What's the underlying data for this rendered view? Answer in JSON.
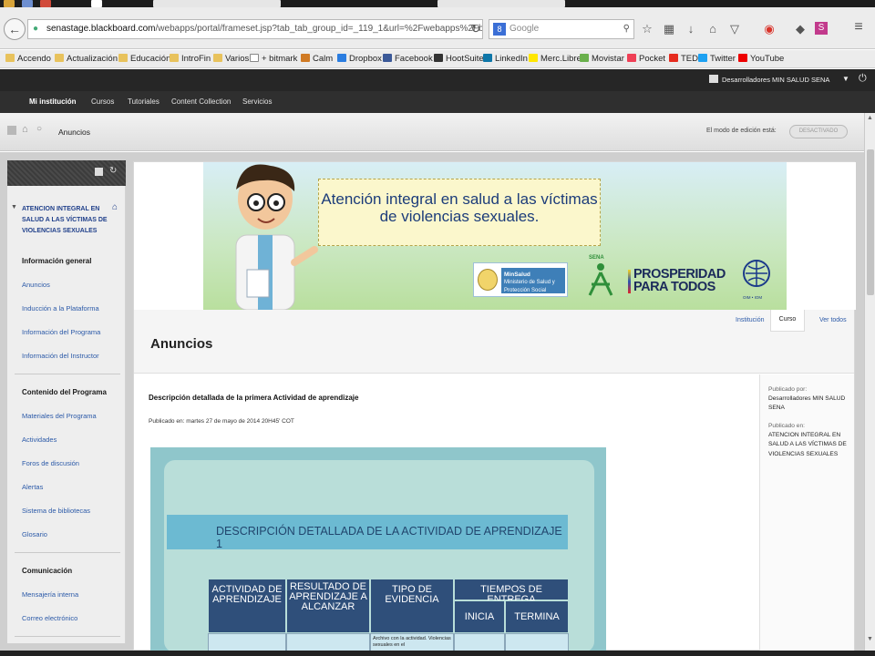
{
  "browser": {
    "url_host": "senastage.blackboard.com",
    "url_path": "/webapps/portal/frameset.jsp?tab_tab_group_id=_119_1&url=%2Fwebapps%2Fblackboard%",
    "search_engine": "Google",
    "icons": [
      "back-icon",
      "lock-icon",
      "reload-icon",
      "search-icon",
      "star-icon",
      "clipboard-icon",
      "download-icon",
      "home-icon",
      "pocket-icon",
      "extension-icon",
      "menu-icon"
    ]
  },
  "bookmarks": [
    {
      "label": "Accendo"
    },
    {
      "label": "Actualización"
    },
    {
      "label": "Educación"
    },
    {
      "label": "IntroFin"
    },
    {
      "label": "Varios"
    },
    {
      "label": "+ bitmark"
    },
    {
      "label": "Calm"
    },
    {
      "label": "Dropbox"
    },
    {
      "label": "Facebook"
    },
    {
      "label": "HootSuite"
    },
    {
      "label": "LinkedIn"
    },
    {
      "label": "Merc.Libre"
    },
    {
      "label": "Movistar"
    },
    {
      "label": "Pocket"
    },
    {
      "label": "TED"
    },
    {
      "label": "Twitter"
    },
    {
      "label": "YouTube"
    }
  ],
  "bb_header": {
    "tabs": [
      {
        "label": "Mi institución",
        "active": true
      },
      {
        "label": "Cursos"
      },
      {
        "label": "Tutoriales"
      },
      {
        "label": "Content Collection"
      },
      {
        "label": "Servicios"
      }
    ],
    "user": "Desarrolladores MIN SALUD SENA"
  },
  "breadcrumb": {
    "current": "Anuncios",
    "edit_mode_label": "El modo de edición está:",
    "edit_mode_value": "DESACTIVADO"
  },
  "sidebar": {
    "course_name": "ATENCION INTEGRAL EN SALUD A LAS VÍCTIMAS DE VIOLENCIAS SEXUALES",
    "sections": [
      {
        "title": "Información general",
        "items": [
          "Anuncios",
          "Inducción a la Plataforma",
          "Información del Programa",
          "Información del Instructor"
        ]
      },
      {
        "title": "Contenido del Programa",
        "items": [
          "Materiales del Programa",
          "Actividades",
          "Foros de discusión",
          "Alertas",
          "Sistema de bibliotecas",
          "Glosario"
        ]
      },
      {
        "title": "Comunicación",
        "items": [
          "Mensajería interna",
          "Correo electrónico"
        ]
      }
    ]
  },
  "banner": {
    "title": "Atención integral en salud a las víctimas de violencias sexuales.",
    "logo_minsalud": "MinSalud",
    "logo_minsalud_sub": "Ministerio de Salud y Protección Social",
    "logo_sena": "SENA",
    "logo_prosperidad": "PROSPERIDAD PARA TODOS",
    "logo_oim": "OIM • IOM"
  },
  "announcements": {
    "heading": "Anuncios",
    "tabs": [
      "Institución",
      "Curso",
      "Ver todos"
    ],
    "post": {
      "title": "Descripción detallada de la primera Actividad de aprendizaje",
      "published": "Publicado en: martes 27 de mayo de 2014 20H45' COT",
      "side_published_by_label": "Publicado por:",
      "side_author": "Desarrolladores MIN SALUD SENA",
      "side_published_in_label": "Publicado en:",
      "side_course": "ATENCION INTEGRAL EN SALUD A LAS VÍCTIMAS DE VIOLENCIAS SEXUALES"
    },
    "embedded": {
      "title": "DESCRIPCIÓN DETALLADA DE LA ACTIVIDAD DE APRENDIZAJE 1",
      "col_activity": "ACTIVIDAD DE APRENDIZAJE",
      "col_result": "RESULTADO DE APRENDIZAJE A ALCANZAR",
      "col_evidence": "TIPO DE EVIDENCIA",
      "col_times": "TIEMPOS DE ENTREGA",
      "col_start": "INICIA",
      "col_end": "TERMINA",
      "cell_evidence": "Archivo con la actividad. Violencias sexuales en el"
    }
  }
}
